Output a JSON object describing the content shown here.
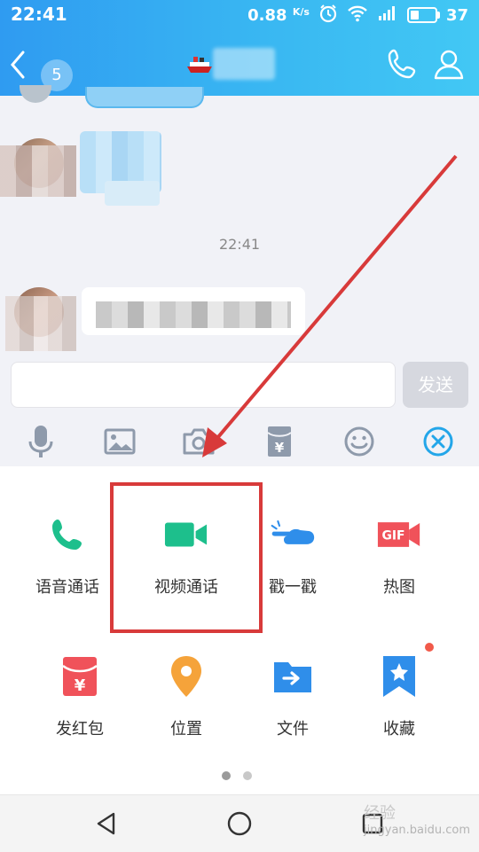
{
  "status_bar": {
    "time": "22:41",
    "speed": "0.88",
    "speed_unit": "K/s",
    "battery": "37"
  },
  "nav": {
    "unread_badge": "5"
  },
  "chat": {
    "timestamp": "22:41"
  },
  "composer": {
    "send_label": "发送"
  },
  "toolbar": {
    "icons": [
      "microphone-icon",
      "image-icon",
      "camera-icon",
      "red-packet-icon",
      "emoji-icon",
      "close-icon"
    ],
    "close_color": "#23a6e9"
  },
  "panel": {
    "items": [
      {
        "label": "语音通话",
        "icon": "phone-icon",
        "color": "#1dbf8c"
      },
      {
        "label": "视频通话",
        "icon": "video-camera-icon",
        "color": "#1dbf8c"
      },
      {
        "label": "戳一戳",
        "icon": "poke-hand-icon",
        "color": "#2f8eea"
      },
      {
        "label": "热图",
        "icon": "gif-icon",
        "color": "#f0525a"
      },
      {
        "label": "发红包",
        "icon": "red-envelope-icon",
        "color": "#f0525a"
      },
      {
        "label": "位置",
        "icon": "location-pin-icon",
        "color": "#f5a33a"
      },
      {
        "label": "文件",
        "icon": "folder-icon",
        "color": "#2f8eea"
      },
      {
        "label": "收藏",
        "icon": "bookmark-star-icon",
        "color": "#2f8eea"
      }
    ],
    "gif_text": "GIF",
    "yen_symbol": "¥",
    "pages": 2,
    "current_page": 1
  },
  "annotation": {
    "highlight_color": "#d83a3a"
  },
  "watermark": {
    "text": "经验",
    "sub": "jingyan.baidu.com"
  }
}
